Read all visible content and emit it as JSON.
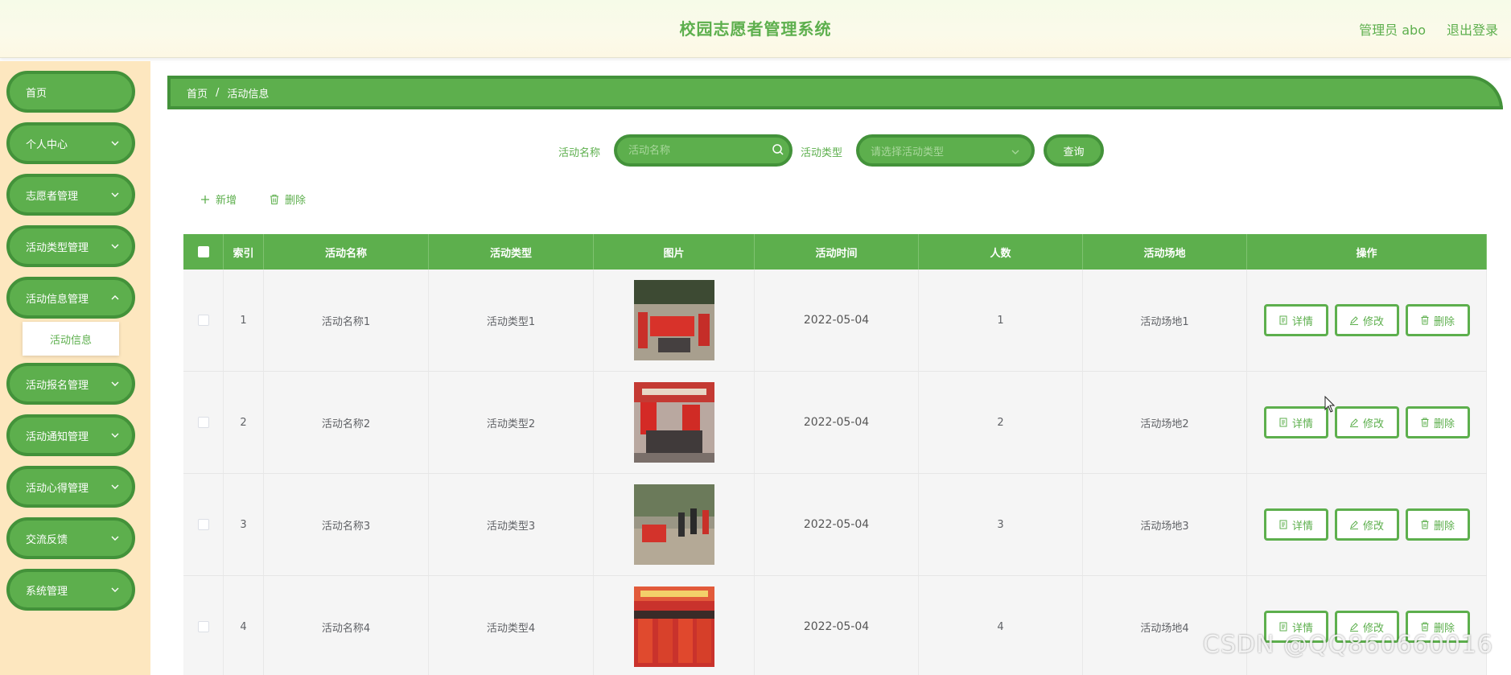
{
  "header": {
    "title": "校园志愿者管理系统",
    "user": "管理员 abo",
    "logout": "退出登录"
  },
  "sidebar": {
    "items": [
      {
        "label": "首页"
      },
      {
        "label": "个人中心"
      },
      {
        "label": "志愿者管理"
      },
      {
        "label": "活动类型管理"
      },
      {
        "label": "活动信息管理"
      },
      {
        "label": "活动报名管理"
      },
      {
        "label": "活动通知管理"
      },
      {
        "label": "活动心得管理"
      },
      {
        "label": "交流反馈"
      },
      {
        "label": "系统管理"
      }
    ],
    "subitem": "活动信息"
  },
  "breadcrumb": {
    "home": "首页",
    "sep": "/",
    "current": "活动信息"
  },
  "search": {
    "name_label": "活动名称",
    "name_placeholder": "活动名称",
    "type_label": "活动类型",
    "type_placeholder": "请选择活动类型",
    "query": "查询"
  },
  "actions": {
    "add": "新增",
    "delete": "删除"
  },
  "table": {
    "headers": [
      "索引",
      "活动名称",
      "活动类型",
      "图片",
      "活动时间",
      "人数",
      "活动场地",
      "操作"
    ],
    "rows": [
      {
        "idx": "1",
        "name": "活动名称1",
        "type": "活动类型1",
        "time": "2022-05-04",
        "num": "1",
        "place": "活动场地1"
      },
      {
        "idx": "2",
        "name": "活动名称2",
        "type": "活动类型2",
        "time": "2022-05-04",
        "num": "2",
        "place": "活动场地2"
      },
      {
        "idx": "3",
        "name": "活动名称3",
        "type": "活动类型3",
        "time": "2022-05-04",
        "num": "3",
        "place": "活动场地3"
      },
      {
        "idx": "4",
        "name": "活动名称4",
        "type": "活动类型4",
        "time": "2022-05-04",
        "num": "4",
        "place": "活动场地4"
      }
    ],
    "ops": {
      "detail": "详情",
      "edit": "修改",
      "delete": "删除"
    }
  },
  "watermark": "CSDN @QQ860660016",
  "colors": {
    "primary": "#5daf4d",
    "primary_dark": "#43923a",
    "sidebar_bg": "#fde7bf"
  }
}
